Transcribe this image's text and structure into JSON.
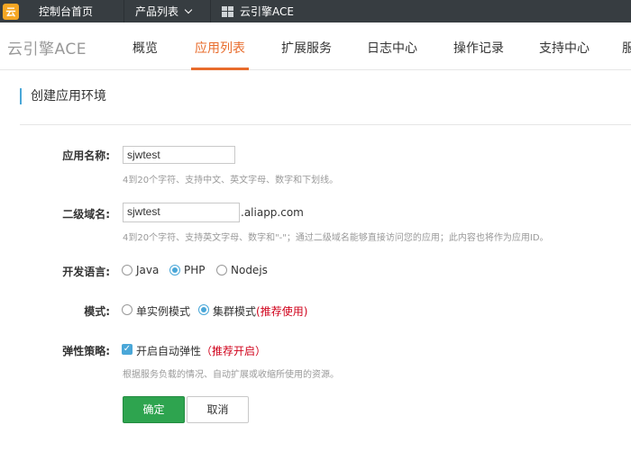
{
  "topbar": {
    "logo_text": "云",
    "home_label": "控制台首页",
    "products_label": "产品列表",
    "current_label": "云引擎ACE"
  },
  "nav": {
    "brand": "云引擎ACE",
    "items": [
      {
        "label": "概览",
        "active": false
      },
      {
        "label": "应用列表",
        "active": true
      },
      {
        "label": "扩展服务",
        "active": false
      },
      {
        "label": "日志中心",
        "active": false
      },
      {
        "label": "操作记录",
        "active": false
      },
      {
        "label": "支持中心",
        "active": false
      },
      {
        "label": "服",
        "active": false
      }
    ]
  },
  "page": {
    "title": "创建应用环境"
  },
  "form": {
    "app_name": {
      "label": "应用名称:",
      "value": "sjwtest",
      "hint": "4到20个字符、支持中文、英文字母、数字和下划线。"
    },
    "domain": {
      "label": "二级域名:",
      "value": "sjwtest",
      "suffix": ".aliapp.com",
      "hint": "4到20个字符、支持英文字母、数字和\"-\"；通过二级域名能够直接访问您的应用；此内容也将作为应用ID。"
    },
    "language": {
      "label": "开发语言:",
      "options": [
        "Java",
        "PHP",
        "Nodejs"
      ],
      "selected": "PHP"
    },
    "mode": {
      "label": "模式:",
      "option1": "单实例模式",
      "option2": "集群模式",
      "option2_note": "(推荐使用)",
      "selected": "集群模式"
    },
    "elastic": {
      "label": "弹性策略:",
      "checkbox_label": "开启自动弹性",
      "note": "（推荐开启）",
      "checked": true,
      "hint": "根据服务负载的情况、自动扩展或收缩所使用的资源。"
    }
  },
  "buttons": {
    "ok": "确定",
    "cancel": "取消"
  },
  "colors": {
    "accent": "#e86c2c",
    "primary_button": "#2ea44f",
    "radio_active": "#4aa7d8",
    "topbar_bg": "#373d41",
    "note_red": "#d0021b"
  }
}
